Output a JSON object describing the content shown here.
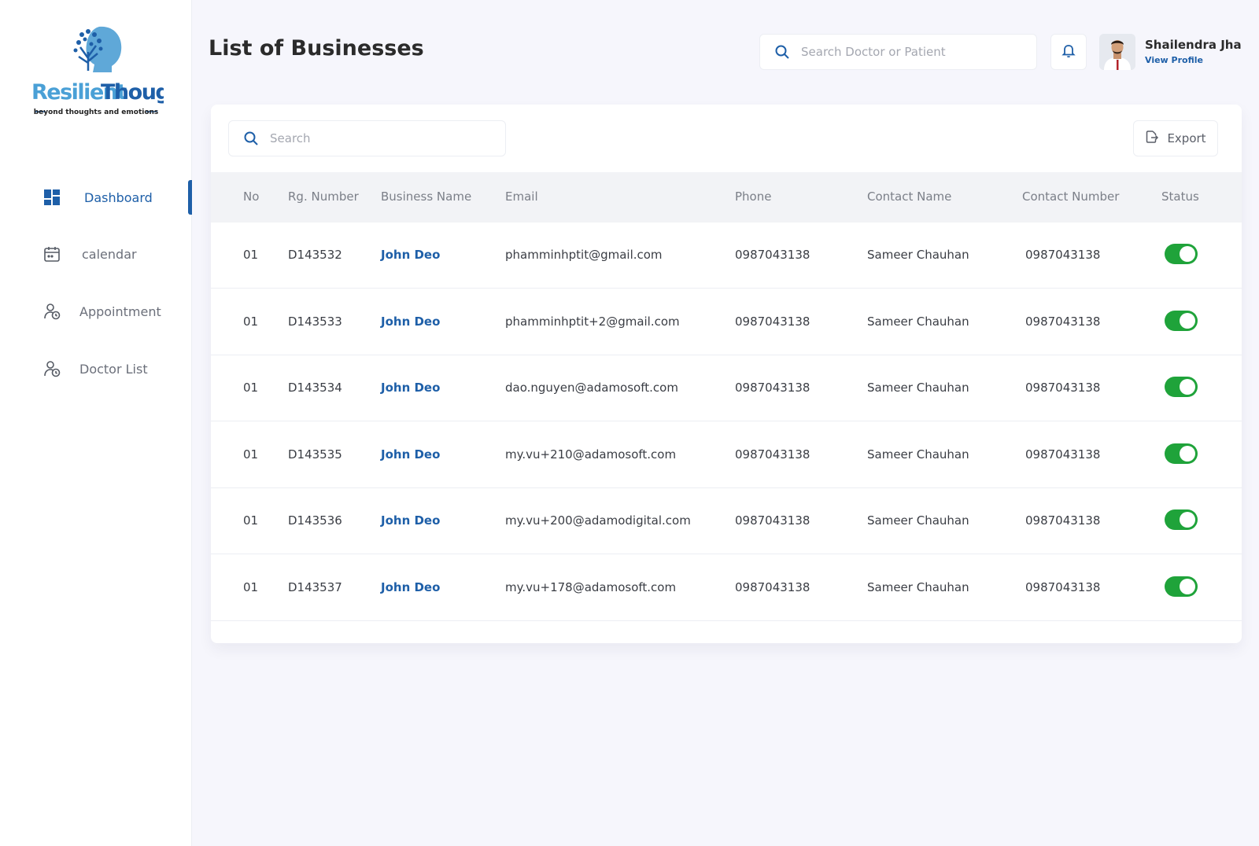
{
  "brand": {
    "name_part1": "Resilient",
    "name_part2": "Thoughts",
    "tagline": "beyond thoughts and emotions"
  },
  "sidebar": {
    "items": [
      {
        "label": "Dashboard",
        "icon": "dashboard-icon",
        "active": true
      },
      {
        "label": "calendar",
        "icon": "calendar-icon",
        "active": false
      },
      {
        "label": "Appointment",
        "icon": "user-clock-icon",
        "active": false
      },
      {
        "label": "Doctor List",
        "icon": "user-clock-icon",
        "active": false
      }
    ]
  },
  "header": {
    "title": "List of Businesses",
    "search_placeholder": "Search Doctor or Patient",
    "user": {
      "name": "Shailendra Jha",
      "view_profile": "View Profile"
    }
  },
  "table": {
    "search_placeholder": "Search",
    "export_label": "Export",
    "columns": [
      "No",
      "Rg. Number",
      "Business Name",
      "Email",
      "Phone",
      "Contact Name",
      "Contact Number",
      "Status"
    ],
    "rows": [
      {
        "no": "01",
        "rg": "D143532",
        "business": "John Deo",
        "email": "phamminhptit@gmail.com",
        "phone": "0987043138",
        "contact_name": "Sameer Chauhan",
        "contact_number": "0987043138",
        "status": true
      },
      {
        "no": "01",
        "rg": "D143533",
        "business": "John Deo",
        "email": "phamminhptit+2@gmail.com",
        "phone": "0987043138",
        "contact_name": "Sameer Chauhan",
        "contact_number": "0987043138",
        "status": true
      },
      {
        "no": "01",
        "rg": "D143534",
        "business": "John Deo",
        "email": "dao.nguyen@adamosoft.com",
        "phone": "0987043138",
        "contact_name": "Sameer Chauhan",
        "contact_number": "0987043138",
        "status": true
      },
      {
        "no": "01",
        "rg": "D143535",
        "business": "John Deo",
        "email": "my.vu+210@adamosoft.com",
        "phone": "0987043138",
        "contact_name": "Sameer Chauhan",
        "contact_number": "0987043138",
        "status": true
      },
      {
        "no": "01",
        "rg": "D143536",
        "business": "John Deo",
        "email": "my.vu+200@adamodigital.com",
        "phone": "0987043138",
        "contact_name": "Sameer Chauhan",
        "contact_number": "0987043138",
        "status": true
      },
      {
        "no": "01",
        "rg": "D143537",
        "business": "John Deo",
        "email": "my.vu+178@adamosoft.com",
        "phone": "0987043138",
        "contact_name": "Sameer Chauhan",
        "contact_number": "0987043138",
        "status": true
      }
    ]
  },
  "colors": {
    "accent": "#1e5fa8",
    "toggle_on": "#1fa33a",
    "background": "#f6f6fc"
  }
}
